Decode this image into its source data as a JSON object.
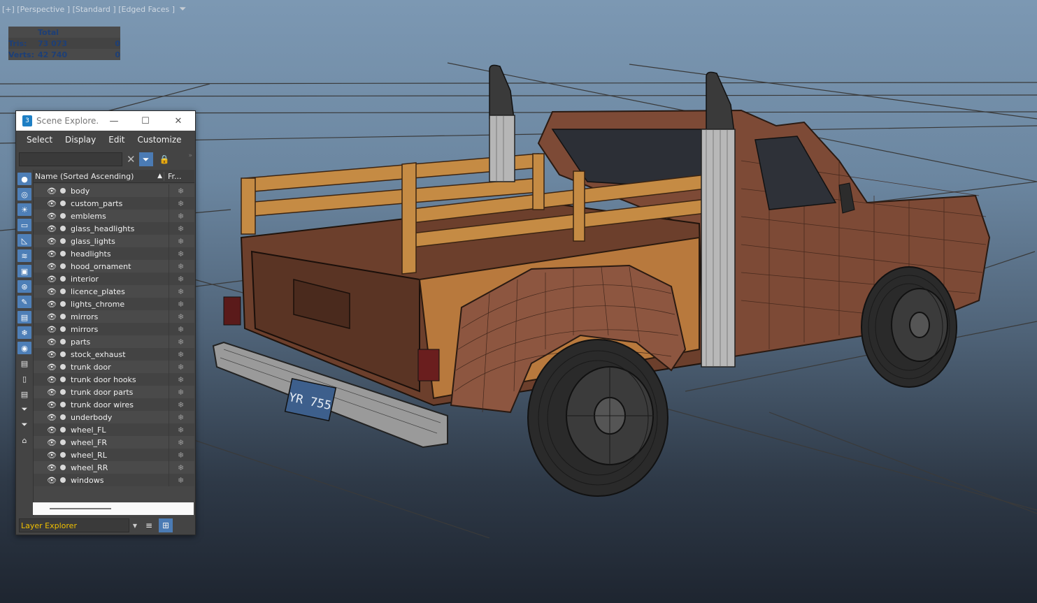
{
  "viewport": {
    "label": "[+] [Perspective ] [Standard ] [Edged Faces ]",
    "filter_icon": "filter-icon"
  },
  "stats": {
    "header": "Total",
    "tris_label": "Tris:",
    "tris_value": "73 073",
    "tris_sel": "0",
    "verts_label": "Verts:",
    "verts_value": "42 740",
    "verts_sel": "0"
  },
  "license_plate": "YR 755",
  "scene_explorer": {
    "title": "Scene Explore...",
    "app_icon": "3",
    "menu": [
      "Select",
      "Display",
      "Edit",
      "Customize"
    ],
    "search_value": "",
    "columns": {
      "name": "Name (Sorted Ascending)",
      "frozen": "Fr..."
    },
    "items": [
      "body",
      "custom_parts",
      "emblems",
      "glass_headlights",
      "glass_lights",
      "headlights",
      "hood_ornament",
      "interior",
      "licence_plates",
      "lights_chrome",
      "mirrors",
      "mirrors",
      "parts",
      "stock_exhaust",
      "trunk door",
      "trunk door hooks",
      "trunk door parts",
      "trunk door wires",
      "underbody",
      "wheel_FL",
      "wheel_FR",
      "wheel_RL",
      "wheel_RR",
      "windows"
    ],
    "footer": {
      "layer_explorer": "Layer Explorer"
    }
  },
  "colors": {
    "accent": "#4b7bb4",
    "layer_text": "#f0c000",
    "stats_text": "#1d3f77"
  }
}
